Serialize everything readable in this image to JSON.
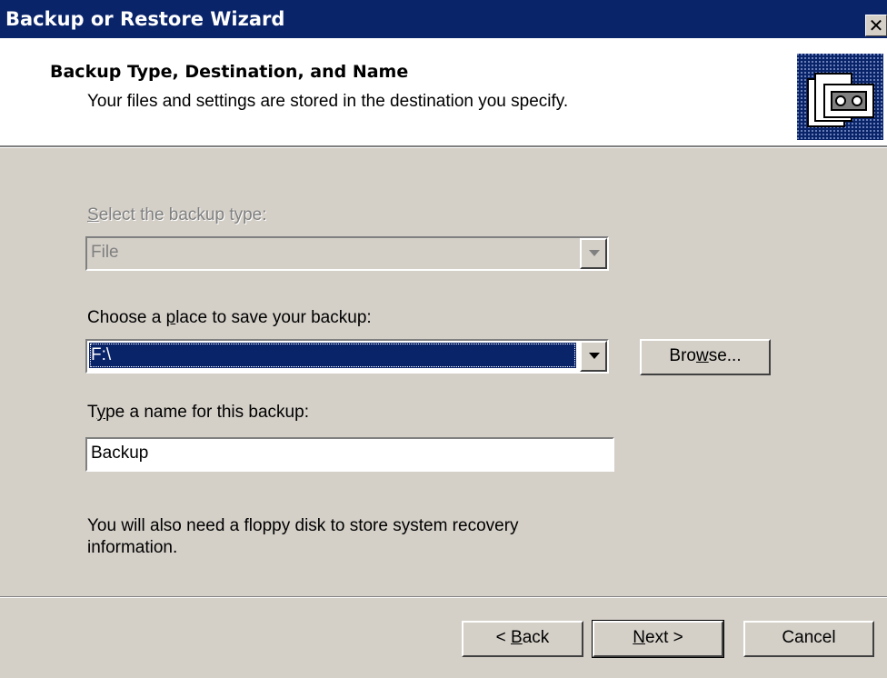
{
  "window": {
    "title": "Backup or Restore Wizard",
    "close_glyph": "✕"
  },
  "header": {
    "title": "Backup Type, Destination, and Name",
    "subtitle": "Your files and settings are stored in the destination you specify."
  },
  "form": {
    "backup_type": {
      "label_u": "S",
      "label_rest": "elect the backup type:",
      "value": "File",
      "enabled": false
    },
    "destination": {
      "label_pre": "Choose a ",
      "label_u": "p",
      "label_post": "lace to save your backup:",
      "value": "F:\\",
      "browse_pre": "Bro",
      "browse_u": "w",
      "browse_post": "se..."
    },
    "name": {
      "label_pre": "T",
      "label_u": "y",
      "label_post": "pe a name for this backup:",
      "value": "Backup"
    },
    "info": "You will also need a floppy disk to store system recovery information."
  },
  "buttons": {
    "back_pre": "< ",
    "back_u": "B",
    "back_post": "ack",
    "next_u": "N",
    "next_post": "ext >",
    "cancel": "Cancel"
  },
  "icons": {
    "close": "close-icon",
    "wizard": "backup-wizard-icon",
    "dropdown": "chevron-down-icon"
  },
  "colors": {
    "titlebar": "#0a246a",
    "dialog_face": "#d4d0c8",
    "selection": "#0a246a"
  }
}
